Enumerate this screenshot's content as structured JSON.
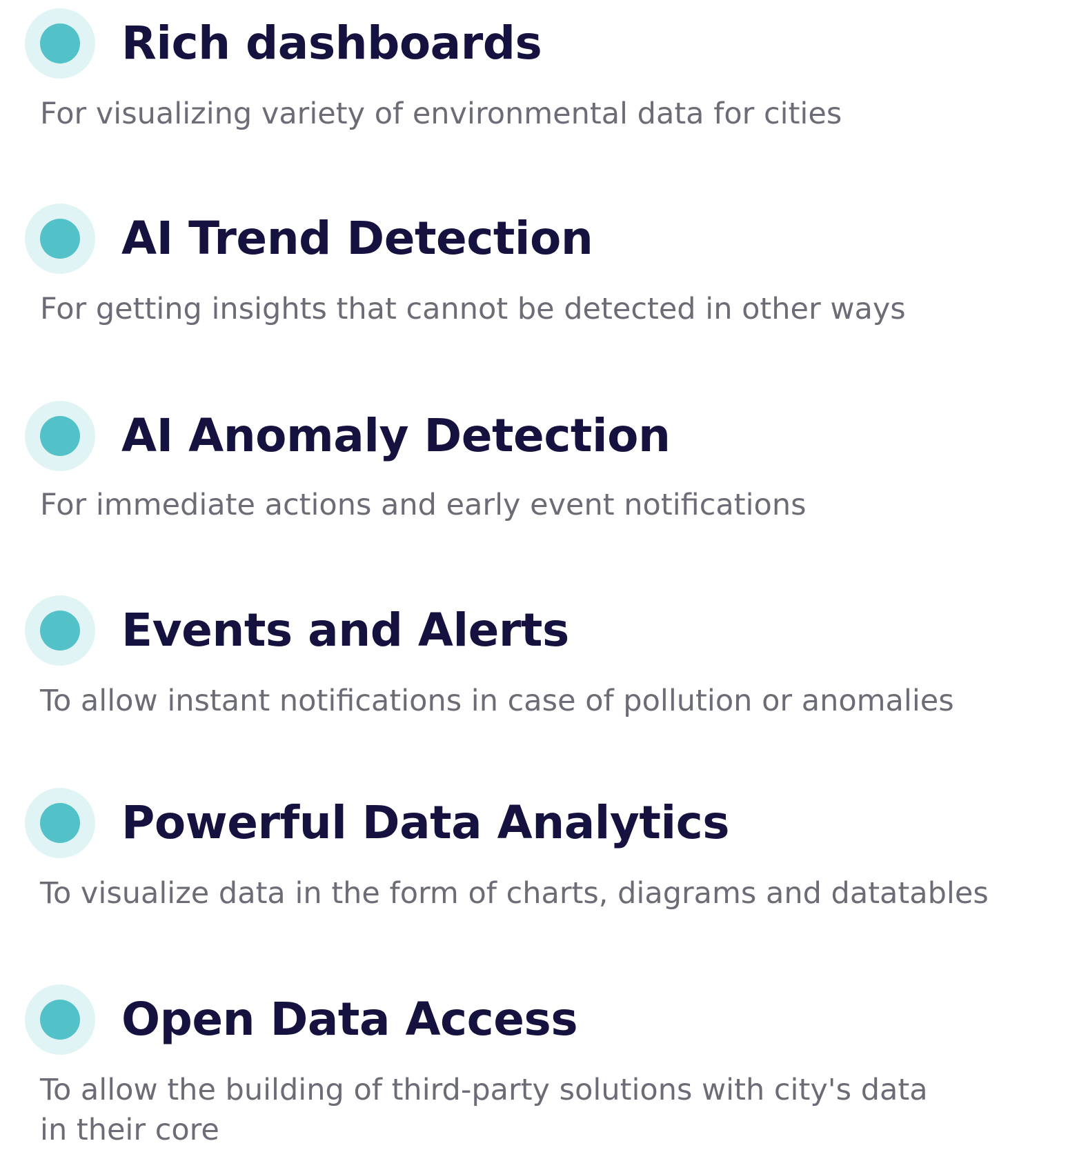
{
  "colors": {
    "accent": "#52c2c8",
    "ring": "#e1f4f5",
    "title": "#15123f",
    "desc": "#6c6c76"
  },
  "features": [
    {
      "icon": "bullet-dot-icon",
      "title": "Rich dashboards",
      "description": "For visualizing variety of environmental data for cities"
    },
    {
      "icon": "bullet-dot-icon",
      "title": "AI Trend Detection",
      "description": "For getting insights that cannot be detected in other ways"
    },
    {
      "icon": "bullet-dot-icon",
      "title": "AI Anomaly Detection",
      "description": "For immediate actions and early event notifications"
    },
    {
      "icon": "bullet-dot-icon",
      "title": "Events and Alerts",
      "description": "To allow instant notifications in case of pollution or anomalies"
    },
    {
      "icon": "bullet-dot-icon",
      "title": "Powerful Data Analytics",
      "description": "To visualize data in the form of charts, diagrams and datatables"
    },
    {
      "icon": "bullet-dot-icon",
      "title": "Open Data Access",
      "description": "To allow the building of third-party solutions with city's data in their core"
    }
  ]
}
